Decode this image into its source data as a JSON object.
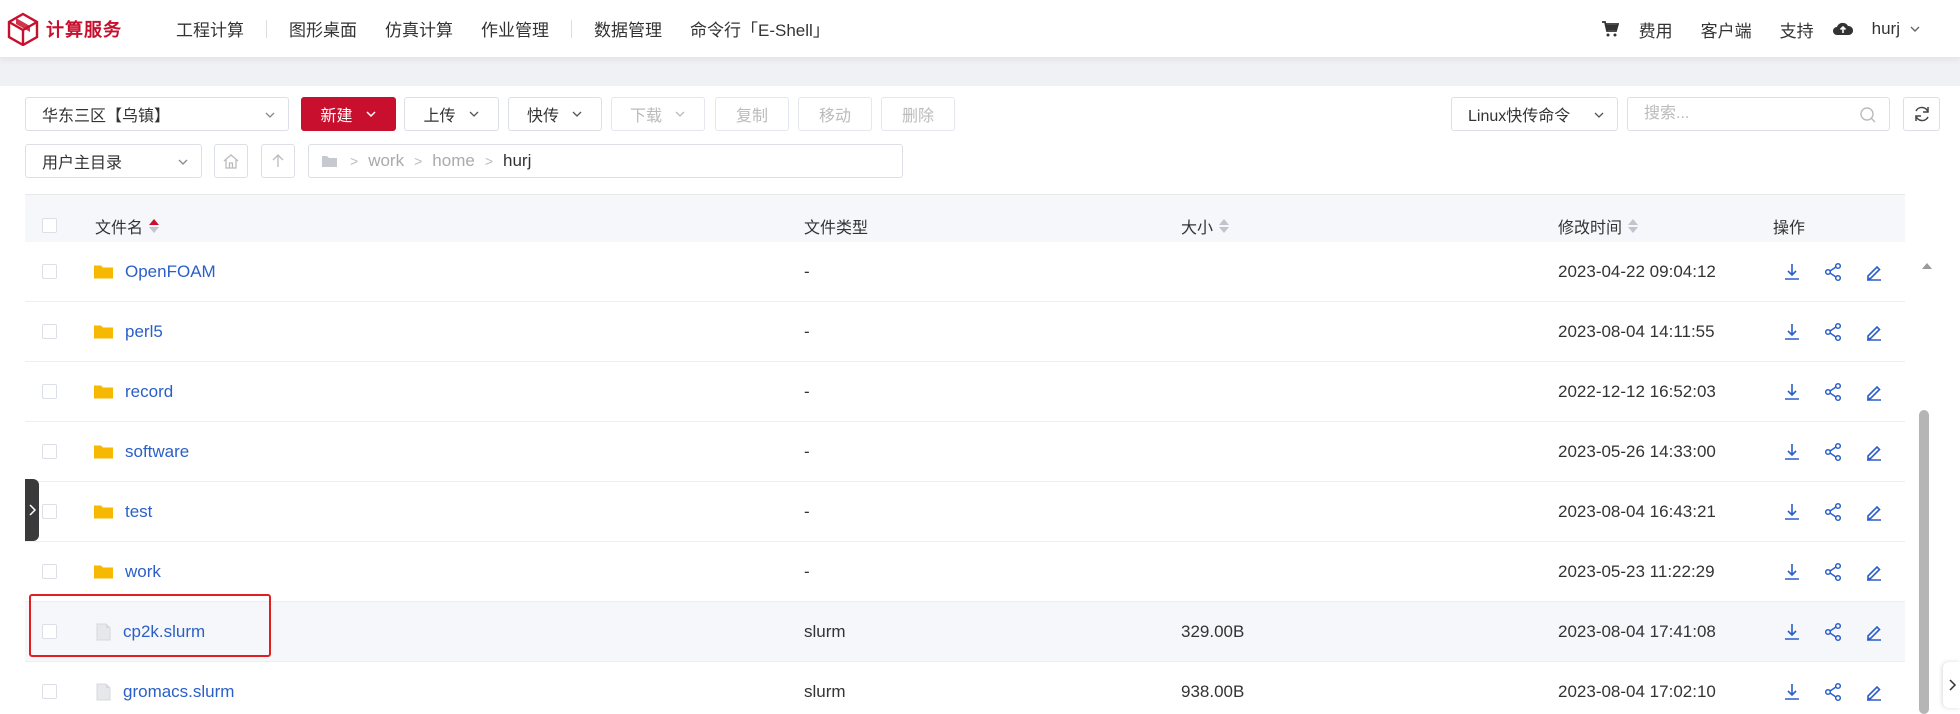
{
  "brand": {
    "name": "计算服务",
    "color": "#c8102e"
  },
  "nav": {
    "items": [
      "工程计算",
      "图形桌面",
      "仿真计算",
      "作业管理",
      "数据管理",
      "命令行「E-Shell」"
    ],
    "right": {
      "cost": "费用",
      "client": "客户端",
      "support": "支持",
      "user": "hurj"
    }
  },
  "toolbar": {
    "region": "华东三区【乌镇】",
    "new": "新建",
    "upload": "上传",
    "fast_transfer": "快传",
    "download": "下载",
    "copy": "复制",
    "move": "移动",
    "delete": "删除",
    "linux_cmd": "Linux快传命令",
    "search_placeholder": "搜索..."
  },
  "location": {
    "dir": "用户主目录",
    "path": [
      "work",
      "home",
      "hurj"
    ]
  },
  "table": {
    "headers": {
      "name": "文件名",
      "type": "文件类型",
      "size": "大小",
      "mtime": "修改时间",
      "ops": "操作"
    },
    "rows": [
      {
        "name": "OpenFOAM",
        "kind": "folder",
        "type": "-",
        "size": "",
        "mtime": "2023-04-22 09:04:12"
      },
      {
        "name": "perl5",
        "kind": "folder",
        "type": "-",
        "size": "",
        "mtime": "2023-08-04 14:11:55"
      },
      {
        "name": "record",
        "kind": "folder",
        "type": "-",
        "size": "",
        "mtime": "2022-12-12 16:52:03"
      },
      {
        "name": "software",
        "kind": "folder",
        "type": "-",
        "size": "",
        "mtime": "2023-05-26 14:33:00"
      },
      {
        "name": "test",
        "kind": "folder",
        "type": "-",
        "size": "",
        "mtime": "2023-08-04 16:43:21"
      },
      {
        "name": "work",
        "kind": "folder",
        "type": "-",
        "size": "",
        "mtime": "2023-05-23 11:22:29"
      },
      {
        "name": "cp2k.slurm",
        "kind": "file",
        "type": "slurm",
        "size": "329.00B",
        "mtime": "2023-08-04 17:41:08"
      },
      {
        "name": "gromacs.slurm",
        "kind": "file",
        "type": "slurm",
        "size": "938.00B",
        "mtime": "2023-08-04 17:02:10"
      }
    ]
  },
  "colors": {
    "accent": "#c8102e",
    "link": "#2b5fc7",
    "folder": "#f6b800",
    "highlight_box": "#e02020"
  }
}
